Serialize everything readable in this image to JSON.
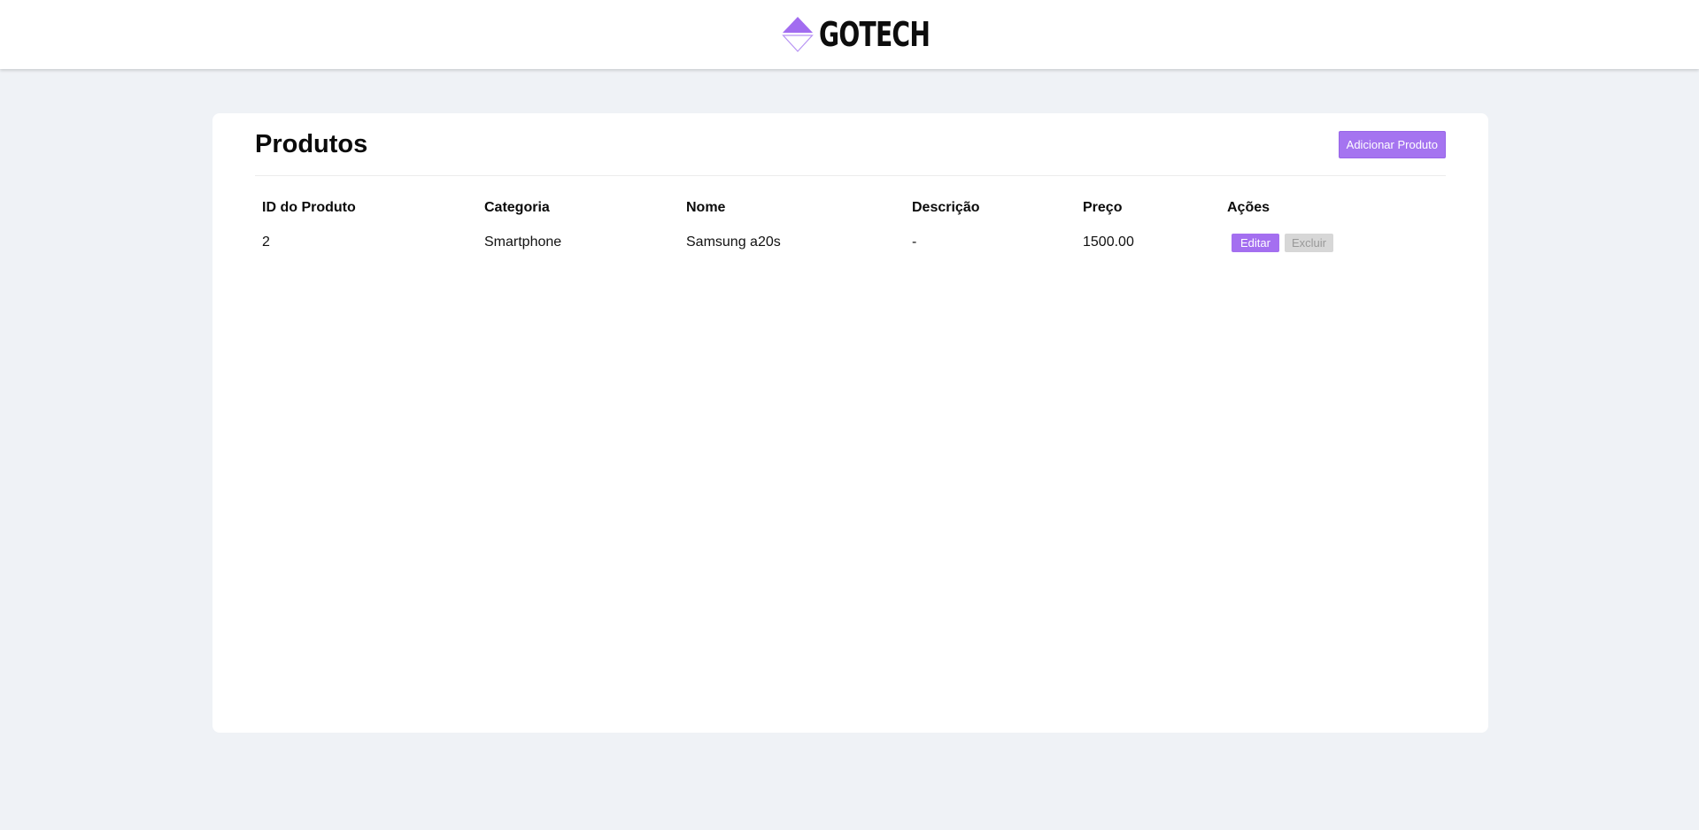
{
  "brand": {
    "name": "GOTECH",
    "logo_icon": "diamond-logo-icon",
    "accent_color": "#a574f0"
  },
  "page": {
    "title": "Produtos",
    "add_button_label": "Adicionar Produto"
  },
  "table": {
    "columns": [
      "ID do Produto",
      "Categoria",
      "Nome",
      "Descrição",
      "Preço",
      "Ações"
    ],
    "rows": [
      {
        "id": "2",
        "category": "Smartphone",
        "name": "Samsung a20s",
        "description": "-",
        "price": "1500.00",
        "edit_label": "Editar",
        "delete_label": "Excluir",
        "delete_disabled": true
      }
    ]
  }
}
